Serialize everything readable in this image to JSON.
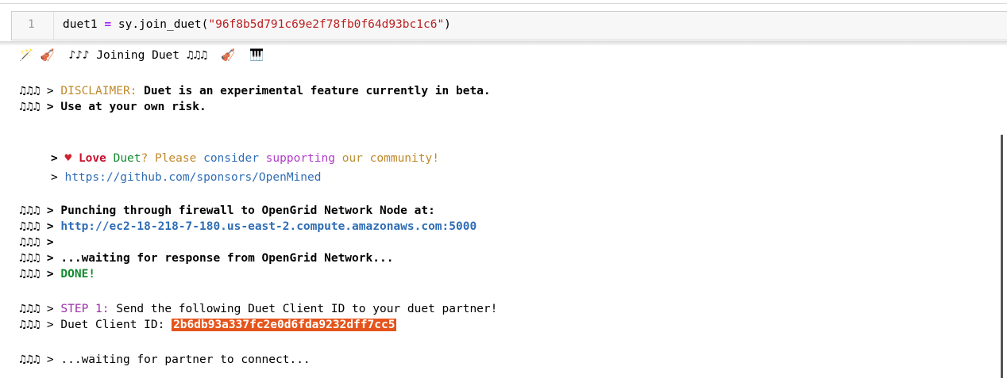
{
  "cell": {
    "line_number": "1",
    "code_var": "duet1",
    "code_op": "=",
    "code_call": "sy.join_duet(",
    "code_arg": "\"96f8b5d791c69e2f78fb0f64d93bc1c6\"",
    "code_close": ")"
  },
  "output": {
    "header": {
      "icon_wand": "🪄",
      "icon_violin": "🎻",
      "text": "♪♪♪ Joining Duet ♫♫♫",
      "icon_violin2": "🎻",
      "icon_piano": "🎹"
    },
    "prefix": "♫♫♫ >",
    "disclaimer_label": "DISCLAIMER:",
    "disclaimer_text": "Duet is an experimental feature currently in beta.",
    "risk_text": "Use at your own risk.",
    "love_prefix": ">",
    "love_heart": "♥",
    "love_word": "Love",
    "duet_word": "Duet",
    "q_please": "? Please",
    "consider": "consider",
    "supporting": "supporting",
    "our": "our",
    "community": "community!",
    "sponsor_prefix": ">",
    "sponsor_url": "https://github.com/sponsors/OpenMined",
    "punch_text": "Punching through firewall to OpenGrid Network Node at:",
    "node_url": "http://ec2-18-218-7-180.us-east-2.compute.amazonaws.com:5000",
    "blank_prefix": "♫♫♫ >",
    "waiting_response": "...waiting for response from OpenGrid Network...",
    "done": "DONE!",
    "step1_label": "STEP 1:",
    "step1_text": "Send the following Duet Client ID to your duet partner!",
    "client_id_label": "Duet Client ID:",
    "client_id": "2b6db93a337fc2e0d6fda9232dff7cc5",
    "waiting_partner": "...waiting for partner to connect..."
  }
}
